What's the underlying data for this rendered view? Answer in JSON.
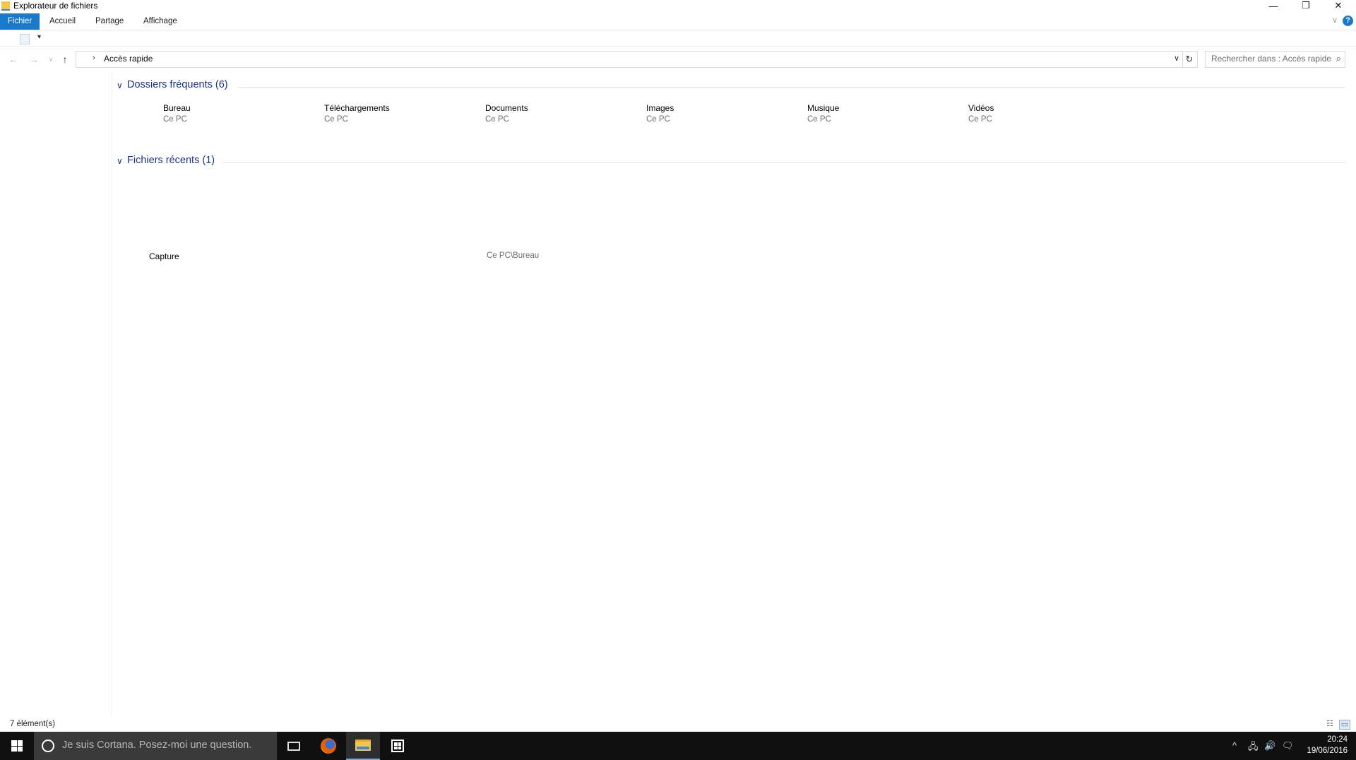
{
  "window": {
    "title": "Explorateur de fichiers",
    "controls": {
      "minimize": "—",
      "restore": "❐",
      "close": "✕"
    }
  },
  "ribbon": {
    "tabs": [
      "Fichier",
      "Accueil",
      "Partage",
      "Affichage"
    ],
    "collapse_glyph": "∨",
    "help_glyph": "?"
  },
  "qat": {
    "dropdown_glyph": "▾"
  },
  "nav": {
    "back": "←",
    "forward": "→",
    "recent": "∨",
    "up": "↑",
    "breadcrumb_chevron": "›",
    "address": "Accès rapide",
    "address_dropdown": "∨",
    "refresh": "↻",
    "search_placeholder": "Rechercher dans : Accès rapide",
    "search_glyph": "⌕"
  },
  "content": {
    "frequent": {
      "title": "Dossiers fréquents (6)",
      "folders": [
        {
          "name": "Bureau",
          "location": "Ce PC"
        },
        {
          "name": "Téléchargements",
          "location": "Ce PC"
        },
        {
          "name": "Documents",
          "location": "Ce PC"
        },
        {
          "name": "Images",
          "location": "Ce PC"
        },
        {
          "name": "Musique",
          "location": "Ce PC"
        },
        {
          "name": "Vidéos",
          "location": "Ce PC"
        }
      ]
    },
    "recent": {
      "title": "Fichiers récents (1)",
      "files": [
        {
          "name": "Capture",
          "path": "Ce PC\\Bureau"
        }
      ]
    },
    "group_chevron": "∨"
  },
  "status": {
    "count": "7 élément(s)",
    "details_glyph": "☷",
    "tiles_glyph": "▭"
  },
  "taskbar": {
    "cortana_placeholder": "Je suis Cortana. Posez-moi une question.",
    "tray": {
      "chevron": "^",
      "network": "🖧",
      "volume": "🔊",
      "notifications": "🗨"
    },
    "clock": {
      "time": "20:24",
      "date": "19/06/2016"
    }
  },
  "colors": {
    "accent": "#1979ca",
    "group_title": "#1e3287",
    "taskbar": "#101010",
    "cortana_box": "#3a3a3a"
  }
}
